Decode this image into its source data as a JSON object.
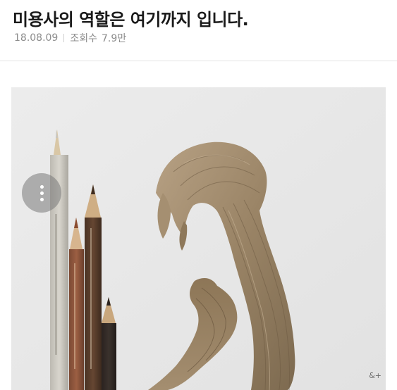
{
  "post": {
    "title": "미용사의 역할은 여기까지 입니다.",
    "date": "18.08.09",
    "views_label": "조회수",
    "views_count": "7.9만"
  },
  "image": {
    "watermark": "&+"
  },
  "icons": {
    "more": "more-vertical-icon"
  },
  "colors": {
    "title": "#1a1a1a",
    "meta": "#8c8c8c",
    "paper": "#ebebeb",
    "hair": "#9a8466"
  }
}
